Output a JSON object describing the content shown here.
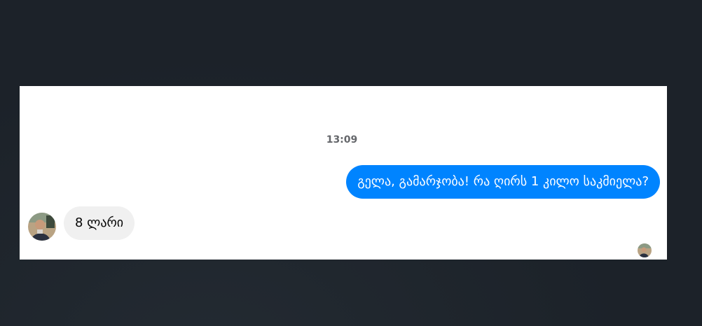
{
  "chat": {
    "timestamp": "13:09",
    "messages": [
      {
        "direction": "outgoing",
        "text": "გელა, გამარჯობა! რა ღირს 1 კილო საკმიელა?"
      },
      {
        "direction": "incoming",
        "text": "8 ლარი"
      }
    ]
  },
  "colors": {
    "outgoing_bubble": "#0084ff",
    "incoming_bubble": "#f0f0f0",
    "page_background": "#1c2229",
    "panel_background": "#ffffff"
  },
  "icons": {
    "sender_avatar": "profile-photo",
    "seen_indicator": "seen-avatar"
  }
}
